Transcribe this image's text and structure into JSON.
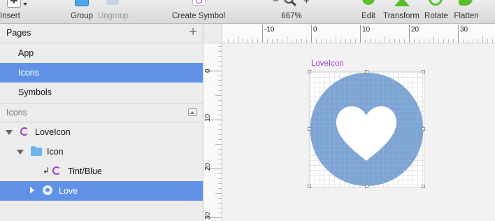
{
  "toolbar": {
    "insert": "Insert",
    "group": "Group",
    "ungroup": "Ungroup",
    "create_symbol": "Create Symbol",
    "zoom_minus": "−",
    "zoom_plus": "+",
    "zoom": "667%",
    "edit": "Edit",
    "transform": "Transform",
    "rotate": "Rotate",
    "flatten": "Flatten"
  },
  "pages": {
    "title": "Pages",
    "add": "+",
    "items": [
      "App",
      "Icons",
      "Symbols"
    ],
    "selected": "Icons"
  },
  "layers": {
    "title": "Icons",
    "items": [
      {
        "label": "LoveIcon",
        "icon": "symbol-icon"
      },
      {
        "label": "Icon",
        "icon": "folder-icon"
      },
      {
        "label": "Tint/Blue",
        "icon": "symbol-icon"
      },
      {
        "label": "Love",
        "icon": "shape-icon"
      }
    ],
    "selected": "Love"
  },
  "rulers": {
    "horizontal": [
      "-10",
      "0",
      "10",
      "20",
      "30"
    ],
    "vertical": [
      "0",
      "10",
      "20",
      "30"
    ]
  },
  "artboard": {
    "label": "LoveIcon"
  },
  "colors": {
    "selection": "#5f91e6",
    "circle": "#7ea4d4",
    "symbol": "#a23cc8",
    "folder": "#6cb6ee",
    "action_green": "#5bbf2b"
  }
}
